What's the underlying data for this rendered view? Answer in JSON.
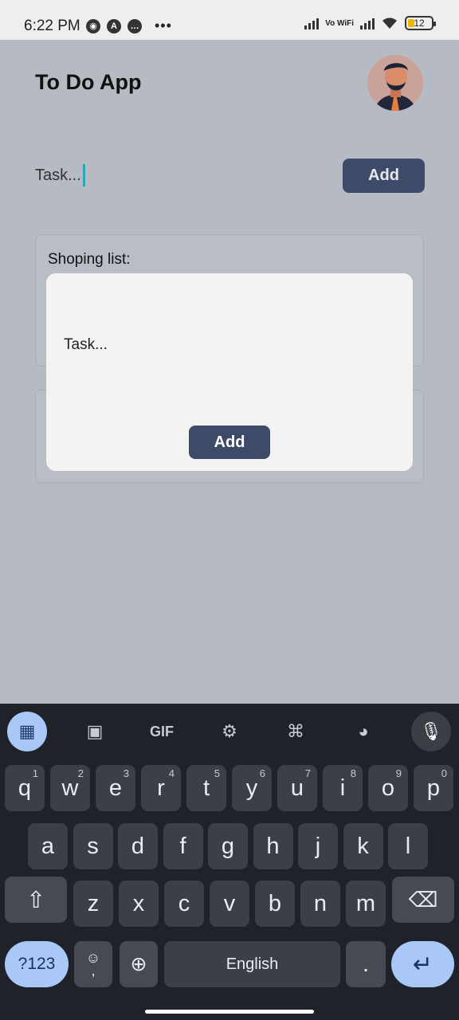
{
  "status": {
    "time": "6:22 PM",
    "battery": "12",
    "vowifi": "Vo\nWiFi"
  },
  "app": {
    "title": "To Do App",
    "task_placeholder": "Task...",
    "add_label": "Add"
  },
  "lists": [
    {
      "title": "Shoping list:"
    },
    {
      "title": ""
    }
  ],
  "modal": {
    "task_placeholder": "Task...",
    "add_label": "Add"
  },
  "keyboard": {
    "row1": [
      {
        "key": "q",
        "num": "1"
      },
      {
        "key": "w",
        "num": "2"
      },
      {
        "key": "e",
        "num": "3"
      },
      {
        "key": "r",
        "num": "4"
      },
      {
        "key": "t",
        "num": "5"
      },
      {
        "key": "y",
        "num": "6"
      },
      {
        "key": "u",
        "num": "7"
      },
      {
        "key": "i",
        "num": "8"
      },
      {
        "key": "o",
        "num": "9"
      },
      {
        "key": "p",
        "num": "0"
      }
    ],
    "row2": [
      "a",
      "s",
      "d",
      "f",
      "g",
      "h",
      "j",
      "k",
      "l"
    ],
    "row3": [
      "z",
      "x",
      "c",
      "v",
      "b",
      "n",
      "m"
    ],
    "symbols": "?123",
    "comma": ",",
    "space": "English",
    "period": "."
  }
}
